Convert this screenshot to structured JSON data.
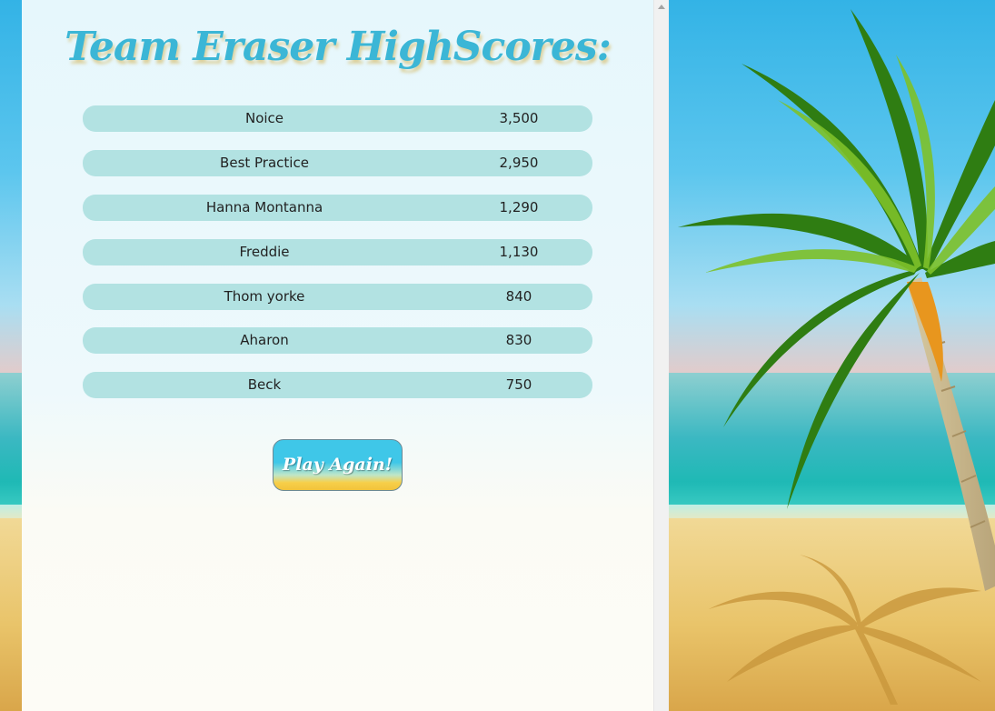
{
  "title": "Team Eraser HighScores:",
  "scores": [
    {
      "name": "Noice",
      "score": "3,500"
    },
    {
      "name": "Best Practice",
      "score": "2,950"
    },
    {
      "name": "Hanna Montanna",
      "score": "1,290"
    },
    {
      "name": "Freddie",
      "score": "1,130"
    },
    {
      "name": "Thom yorke",
      "score": "840"
    },
    {
      "name": "Aharon",
      "score": "830"
    },
    {
      "name": "Beck",
      "score": "750"
    }
  ],
  "play_again_label": "Play Again!",
  "colors": {
    "title": "#3bb6d6",
    "row_background": "#b2e2e2",
    "button_top": "#3fc7e8",
    "button_bottom": "#f2c33a"
  },
  "icons": [
    "palm-tree-icon",
    "scroll-up-arrow-icon"
  ]
}
